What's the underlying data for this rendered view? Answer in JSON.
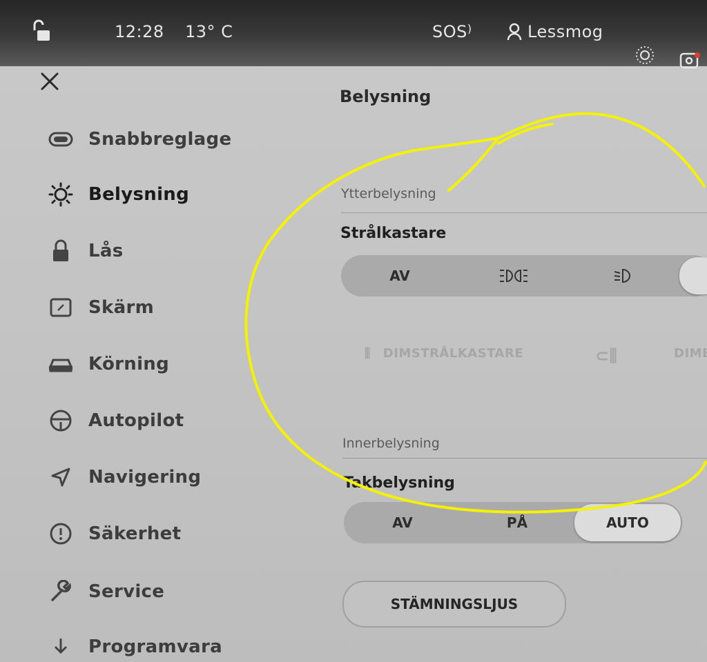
{
  "status": {
    "time": "12:28",
    "temperature": "13° C",
    "sos": "SOS",
    "profile_name": "Lessmog"
  },
  "sidebar": {
    "items": [
      {
        "label": "Snabbreglage",
        "icon": "toggle-icon"
      },
      {
        "label": "Belysning",
        "icon": "light-bulb-icon",
        "active": true
      },
      {
        "label": "Lås",
        "icon": "lock-icon"
      },
      {
        "label": "Skärm",
        "icon": "display-icon"
      },
      {
        "label": "Körning",
        "icon": "car-icon"
      },
      {
        "label": "Autopilot",
        "icon": "steering-wheel-icon"
      },
      {
        "label": "Navigering",
        "icon": "navigation-arrow-icon"
      },
      {
        "label": "Säkerhet",
        "icon": "alert-circle-icon"
      },
      {
        "label": "Service",
        "icon": "wrench-icon"
      },
      {
        "label": "Programvara",
        "icon": "download-icon"
      }
    ]
  },
  "main": {
    "title": "Belysning",
    "exterior": {
      "section_label": "Ytterbelysning",
      "headlights_title": "Strålkastare",
      "headlight_options": [
        "AV",
        "parking-lights-icon",
        "low-beam-icon"
      ],
      "fog_left": "DIMSTRÅLKASTARE",
      "fog_right": "DIMB"
    },
    "interior": {
      "section_label": "Innerbelysning",
      "ceiling_title": "Takbelysning",
      "ceiling_options": [
        "AV",
        "PÅ",
        "AUTO"
      ],
      "ceiling_selected": "AUTO",
      "ambient_button": "STÄMNINGSLJUS"
    }
  },
  "colors": {
    "annotation": "#f5f200",
    "statusbar": "#2c2c2c"
  }
}
